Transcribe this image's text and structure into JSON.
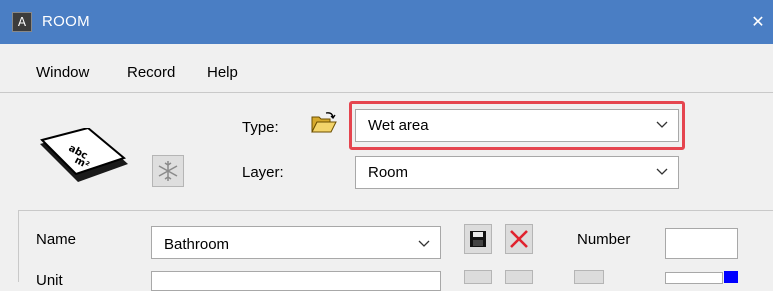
{
  "window": {
    "title": "ROOM",
    "app_icon_glyph": "A",
    "close_glyph": "✕",
    "titlebar_color": "#4a7ec4"
  },
  "menu": {
    "items": [
      "Window",
      "Record",
      "Help"
    ]
  },
  "header": {
    "type_label": "Type:",
    "type_value": "Wet area",
    "layer_label": "Layer:",
    "layer_value": "Room",
    "highlight_color": "#e5454f",
    "icons": {
      "logo": "room-area-icon",
      "snowflake": "snowflake-icon",
      "folder": "open-folder-icon"
    }
  },
  "lower": {
    "name_label": "Name",
    "name_value": "Bathroom",
    "number_label": "Number",
    "number_value": "",
    "unit_label": "Unit",
    "icons": {
      "save": "save-icon",
      "delete": "delete-icon"
    },
    "color_swatch": "#0000ff"
  }
}
